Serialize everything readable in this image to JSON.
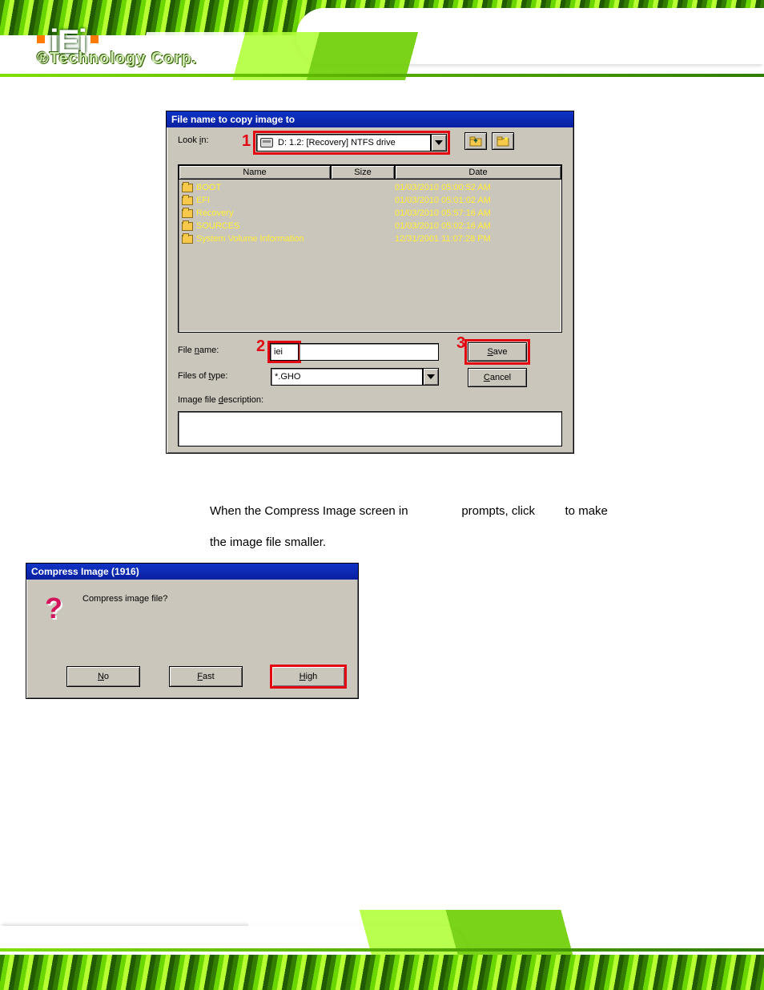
{
  "logo": {
    "brand": "iEi",
    "tagline": "®Technology Corp."
  },
  "dialog1": {
    "title": "File name to copy image to",
    "look_in_label_pre": "Look ",
    "look_in_mn": "i",
    "look_in_label_post": "n:",
    "look_in_value": "D: 1.2: [Recovery] NTFS drive",
    "columns": {
      "name": "Name",
      "size": "Size",
      "date": "Date"
    },
    "files": [
      {
        "name": "BOOT",
        "size": "",
        "date": "01/03/2010 05:00:52 AM"
      },
      {
        "name": "EFI",
        "size": "",
        "date": "01/03/2010 05:01:02 AM"
      },
      {
        "name": "Recovery",
        "size": "",
        "date": "01/03/2010 05:57:16 AM"
      },
      {
        "name": "SOURCES",
        "size": "",
        "date": "01/03/2010 05:02:16 AM"
      },
      {
        "name": "System Volume Information",
        "size": "",
        "date": "12/31/2001 11:07:28 PM"
      }
    ],
    "file_name_label_pre": "File ",
    "file_name_mn": "n",
    "file_name_label_post": "ame:",
    "file_name_value": "iei",
    "files_of_type_label_pre": "Files of ",
    "files_of_type_mn": "t",
    "files_of_type_label_post": "ype:",
    "files_of_type_value": "*.GHO",
    "image_desc_label_pre": "Image file ",
    "image_desc_mn": "d",
    "image_desc_label_post": "escription:",
    "save_mn": "S",
    "save_post": "ave",
    "cancel_mn": "C",
    "cancel_post": "ancel",
    "annot_1": "1",
    "annot_2": "2",
    "annot_3": "3"
  },
  "instruction": {
    "part1": "When the Compress Image screen in",
    "part2": "prompts, click",
    "part3": "to make",
    "part4": "the image file smaller."
  },
  "dialog2": {
    "title": "Compress Image (1916)",
    "message": "Compress image file?",
    "no_mn": "N",
    "no_post": "o",
    "fast_mn": "F",
    "fast_post": "ast",
    "high_mn": "H",
    "high_post": "igh"
  }
}
